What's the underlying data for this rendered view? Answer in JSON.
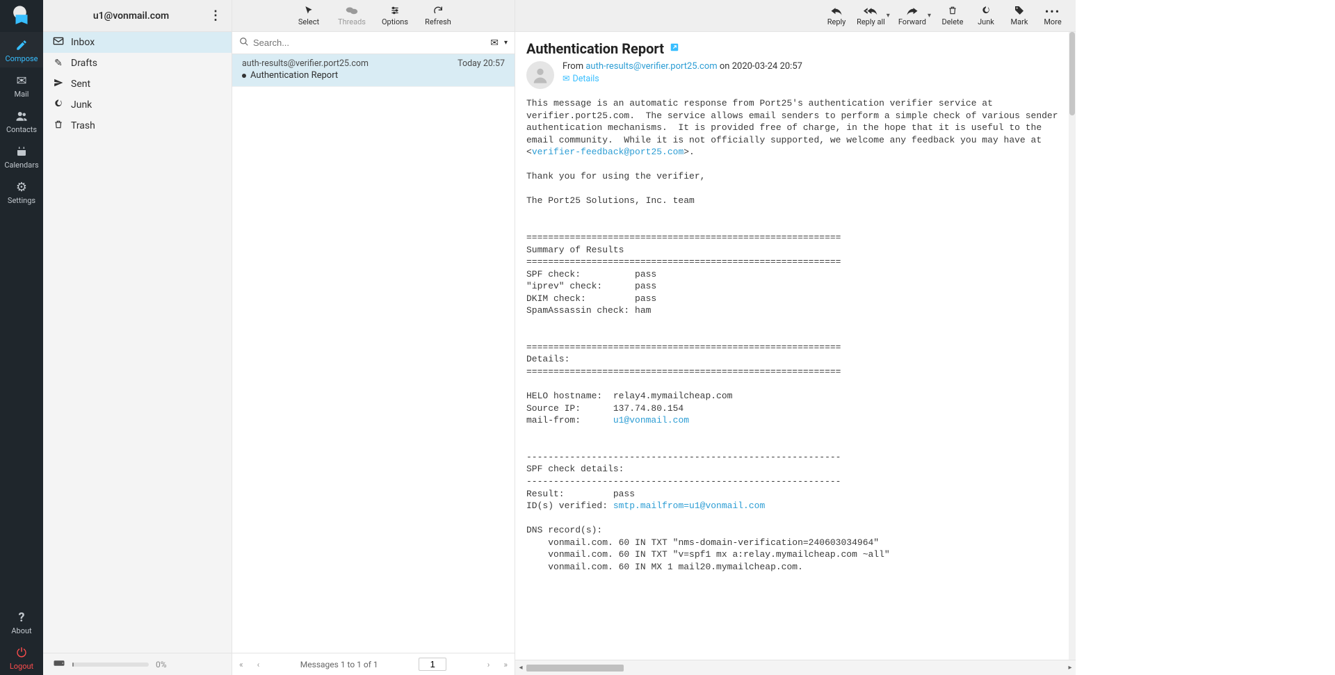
{
  "account": {
    "email": "u1@vonmail.com"
  },
  "nav": {
    "compose": "Compose",
    "mail": "Mail",
    "contacts": "Contacts",
    "calendars": "Calendars",
    "settings": "Settings",
    "about": "About",
    "logout": "Logout"
  },
  "folders": {
    "inbox": "Inbox",
    "drafts": "Drafts",
    "sent": "Sent",
    "junk": "Junk",
    "trash": "Trash"
  },
  "quota": {
    "percent": "0%"
  },
  "list_toolbar": {
    "select": "Select",
    "threads": "Threads",
    "options": "Options",
    "refresh": "Refresh"
  },
  "search": {
    "placeholder": "Search..."
  },
  "messages": [
    {
      "from": "auth-results@verifier.port25.com",
      "subject": "Authentication Report",
      "date": "Today 20:57"
    }
  ],
  "list_footer": {
    "status": "Messages 1 to 1 of 1",
    "page": "1"
  },
  "preview_toolbar": {
    "reply": "Reply",
    "reply_all": "Reply all",
    "forward": "Forward",
    "delete": "Delete",
    "junk": "Junk",
    "mark": "Mark",
    "more": "More"
  },
  "preview": {
    "subject": "Authentication Report",
    "from_label": "From",
    "from_email": "auth-results@verifier.port25.com",
    "on_label": "on",
    "date": "2020-03-24 20:57",
    "details": "Details",
    "body_intro1": "This message is an automatic response from Port25's authentication verifier service at verifier.port25.com.  The service allows email senders to perform a simple check of various sender authentication mechanisms.  It is provided free of charge, in the hope that it is useful to the email community.  While it is not officially supported, we welcome any feedback you may have at <",
    "feedback_link": "verifier-feedback@port25.com",
    "body_intro2": ">.",
    "thanks": "Thank you for using the verifier,",
    "team": "The Port25 Solutions, Inc. team",
    "sep": "==========================================================",
    "sep2": "----------------------------------------------------------",
    "summary_title": "Summary of Results",
    "summary_spf": "SPF check:          pass",
    "summary_iprev": "\"iprev\" check:      pass",
    "summary_dkim": "DKIM check:         pass",
    "summary_sa": "SpamAssassin check: ham",
    "details_title": "Details:",
    "helo": "HELO hostname:  relay4.mymailcheap.com",
    "sourceip": "Source IP:      137.74.80.154",
    "mailfrom_label": "mail-from:      ",
    "mailfrom_link": "u1@vonmail.com",
    "spf_details_title": "SPF check details:",
    "spf_result": "Result:         pass",
    "spf_id_label": "ID(s) verified: ",
    "spf_id_link": "smtp.mailfrom=u1@vonmail.com",
    "dns_title": "DNS record(s):",
    "dns1": "    vonmail.com. 60 IN TXT \"nms-domain-verification=240603034964\"",
    "dns2": "    vonmail.com. 60 IN TXT \"v=spf1 mx a:relay.mymailcheap.com ~all\"",
    "dns3": "    vonmail.com. 60 IN MX 1 mail20.mymailcheap.com."
  }
}
